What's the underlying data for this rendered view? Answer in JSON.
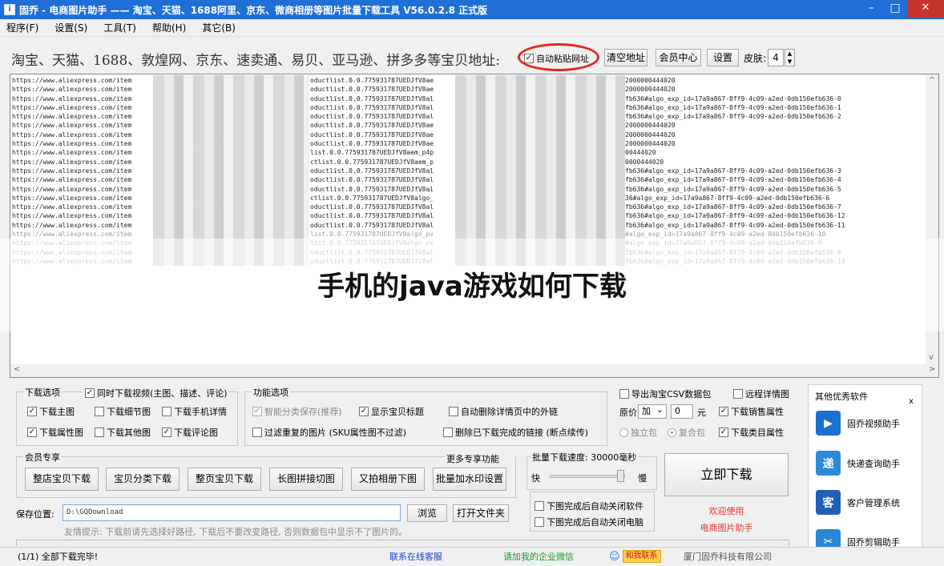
{
  "window": {
    "icon_glyph": "i",
    "title": "固乔 - 电商图片助手 —— 淘宝、天猫、1688阿里、京东、微商相册等图片批量下载工具 V56.0.2.8 正式版",
    "minimize": "–",
    "maximize": "□",
    "close": "✕"
  },
  "menu": [
    "程序(F)",
    "设置(S)",
    "工具(T)",
    "帮助(H)",
    "其它(B)"
  ],
  "toolbar": {
    "address_label": "淘宝、天猫、1688、敦煌网、京东、速卖通、易贝、亚马逊、拼多多等宝贝地址:",
    "auto_paste_label": "自动粘贴网址",
    "auto_paste_checked": "✓",
    "clear_label": "清空地址",
    "member_label": "会员中心",
    "settings_label": "设置",
    "skin_label": "皮肤:",
    "skin_value": "4",
    "spin_arrows": "▲\n▼",
    "annotation_color": "#e52620"
  },
  "urls": {
    "lines": [
      {
        "a": "https://www.aliexpress.com/item",
        "b": "oductlist.0.0.775931787UEDJfV8ae",
        "c": "2000000444020",
        "faded": false
      },
      {
        "a": "https://www.aliexpress.com/item",
        "b": "oductlist.0.0.775931787UEDJfV8ae",
        "c": "2000000444020",
        "faded": false
      },
      {
        "a": "https://www.aliexpress.com/item",
        "b": "oductlist.0.0.775931787UEDJfV8al",
        "c": "fb636#algo_exp_id=17a9a867-8ff9-4c09-a2ed-0db150efb636-0",
        "faded": false
      },
      {
        "a": "https://www.aliexpress.com/item",
        "b": "oductlist.0.0.775931787UEDJfV8al",
        "c": "fb636#algo_exp_id=17a9a867-8ff9-4c09-a2ed-0db150efb636-1",
        "faded": false
      },
      {
        "a": "https://www.aliexpress.com/item",
        "b": "oductlist.0.0.775931787UEDJfV8al",
        "c": "fb636#algo_exp_id=17a9a867-8ff9-4c09-a2ed-0db150efb636-2",
        "faded": false
      },
      {
        "a": "https://www.aliexpress.com/item",
        "b": "oductlist.0.0.775931787UEDJfV8ae",
        "c": "2000000444020",
        "faded": false
      },
      {
        "a": "https://www.aliexpress.com/item",
        "b": "oductlist.0.0.775931787UEDJfV8ae",
        "c": "2000000444020",
        "faded": false
      },
      {
        "a": "https://www.aliexpress.com/item",
        "b": "oductlist.0.0.775931787UEDJfV8ae",
        "c": "2000000444020",
        "faded": false
      },
      {
        "a": "https://www.aliexpress.com/item",
        "b": "list.0.0.775931787UEDJfV8aem_p4p",
        "c": "00444020",
        "faded": false
      },
      {
        "a": "https://www.aliexpress.com/item",
        "b": "ctlist.0.0.775931787UEDJfV8aem_p",
        "c": "0000444020",
        "faded": false
      },
      {
        "a": "https://www.aliexpress.com/item",
        "b": "oductlist.0.0.775931787UEDJfV8al",
        "c": "fb636#algo_exp_id=17a9a867-8ff9-4c09-a2ed-0db150efb636-3",
        "faded": false
      },
      {
        "a": "https://www.aliexpress.com/item",
        "b": "oductlist.0.0.775931787UEDJfV8al",
        "c": "fb636#algo_exp_id=17a9a867-8ff9-4c09-a2ed-0db150efb636-4",
        "faded": false
      },
      {
        "a": "https://www.aliexpress.com/item",
        "b": "oductlist.0.0.775931787UEDJfV8al",
        "c": "fb636#algo_exp_id=17a9a867-8ff9-4c09-a2ed-0db150efb636-5",
        "faded": false
      },
      {
        "a": "https://www.aliexpress.com/item",
        "b": "ctlist.0.0.775931787UEDJfV8algo_",
        "c": "36#algo_exp_id=17a9a867-8ff9-4c09-a2ed-0db150efb636-6",
        "faded": false
      },
      {
        "a": "https://www.aliexpress.com/item",
        "b": "oductlist.0.0.775931787UEDJfV8al",
        "c": "fb636#algo_exp_id=17a9a867-8ff9-4c09-a2ed-0db150efb636-7",
        "faded": false
      },
      {
        "a": "https://www.aliexpress.com/item",
        "b": "oductlist.0.0.775931787UEDJfV8al",
        "c": "fb636#algo_exp_id=17a9a867-8ff9-4c09-a2ed-0db150efb636-12",
        "faded": false
      },
      {
        "a": "https://www.aliexpress.com/item",
        "b": "oductlist.0.0.775931787UEDJfV8al",
        "c": "fb636#algo_exp_id=17a9a867-8ff9-4c09-a2ed-0db150efb636-11",
        "faded": false
      },
      {
        "a": "https://www.aliexpress.com/item",
        "b": "list.0.0.775931787UEDJfV8algo_pv",
        "c": "#algo_exp_id=17a9a867-8ff9-4c09-a2ed-0db150efb636-10",
        "faded": true
      },
      {
        "a": "https://www.aliexpress.com/item",
        "b": "list.0.0.775931787UEDJfV8algo_pv",
        "c": "#algo_exp_id=17a9a867-8ff9-4c09-a2ed-0db150efb636-9",
        "faded": true
      },
      {
        "a": "https://www.aliexpress.com/item",
        "b": "oductlist.0.0.775931787UEDJfV8al",
        "c": "fb636#algo_exp_id=17a9a867-8ff9-4c09-a2ed-0db150efb636-8",
        "faded": true
      },
      {
        "a": "https://www.aliexpress.com/item",
        "b": "oductlist.0.0.775931787UEDJfV8al",
        "c": "fb636#algo_exp_id=17a9a867-8ff9-4c09-a2ed-0db150efb636-13",
        "faded": true
      }
    ],
    "scroll_up": "^",
    "scroll_down": "v",
    "scroll_left": "<",
    "scroll_right": ">"
  },
  "overlay": {
    "text": "手机的java游戏如何下载"
  },
  "download_options": {
    "title": "下载选项",
    "items": [
      {
        "label": "同时下载视频(主图、描述、评论)",
        "checked": "✓"
      },
      {
        "label": "下载主图",
        "checked": "✓"
      },
      {
        "label": "下载细节图",
        "checked": ""
      },
      {
        "label": "下载手机详情",
        "checked": ""
      },
      {
        "label": "下载属性图",
        "checked": "✓"
      },
      {
        "label": "下载其他图",
        "checked": ""
      },
      {
        "label": "下载评论图",
        "checked": "✓"
      }
    ]
  },
  "function_options": {
    "title": "功能选项",
    "items": [
      {
        "label": "智能分类保存(推荐)",
        "checked": "✓",
        "disabled": true
      },
      {
        "label": "显示宝贝标题",
        "checked": "✓",
        "disabled": false
      },
      {
        "label": "自动删除详情页中的外链",
        "checked": "",
        "disabled": false
      },
      {
        "label": "过滤重复的图片 (SKU属性图不过滤)",
        "checked": "",
        "disabled": false
      },
      {
        "label": "删除已下载完成的链接 (断点续传)",
        "checked": "",
        "disabled": false
      }
    ]
  },
  "csv": {
    "export_label": "导出淘宝CSV数据包",
    "export_checked": "",
    "remote_label": "远程详情图",
    "remote_checked": "",
    "price_label": "原价",
    "price_op": "加",
    "price_value": "0",
    "price_unit": "元",
    "sales_label": "下载销售属性",
    "sales_checked": "✓",
    "standalone_label": "独立包",
    "composite_label": "复合包",
    "category_label": "下载类目属性",
    "category_checked": "✓",
    "select_arrow": "⌄"
  },
  "member": {
    "title": "会员专享",
    "more": "更多专享功能>>>",
    "buttons": [
      "整店宝贝下载",
      "宝贝分类下载",
      "整页宝贝下载",
      "长图拼接切图",
      "又拍相册下图",
      "批量加水印设置"
    ]
  },
  "speed": {
    "title": "批量下载速度: 30000毫秒",
    "fast": "快",
    "slow": "慢",
    "close_app_label": "下图完成后自动关闭软件",
    "shutdown_label": "下图完成后自动关闭电脑",
    "close_app_checked": "",
    "shutdown_checked": ""
  },
  "download_button": "立即下载",
  "welcome": {
    "line1": "欢迎使用",
    "line2": "电商图片助手"
  },
  "save": {
    "label": "保存位置:",
    "path": "D:\\GQDownload",
    "browse": "浏览",
    "open_folder": "打开文件夹",
    "tip": "友情提示: 下载前请先选择好路径, 下载后不要改变路径, 否则数据包中显示不了图片的。"
  },
  "side": {
    "title": "其他优秀软件",
    "close": "x",
    "items": [
      {
        "label": "固乔视频助手",
        "glyph": "▶",
        "color": "#1a6fcf"
      },
      {
        "label": "快递查询助手",
        "glyph": "递",
        "color": "#2c8ad8"
      },
      {
        "label": "客户管理系统",
        "glyph": "客",
        "color": "#1f5fb6"
      },
      {
        "label": "固乔剪辑助手",
        "glyph": "✂",
        "color": "#2a86d6"
      }
    ]
  },
  "status": {
    "progress": "(1/1) 全部下载完毕!",
    "service": "联系在线客服",
    "wechat": "请加我的企业微信",
    "contact_icon": "☺",
    "contact": "和我联系",
    "company": "厦门固乔科技有限公司",
    "service_color": "#1a3fc4",
    "wechat_color": "#1a9a2a"
  }
}
